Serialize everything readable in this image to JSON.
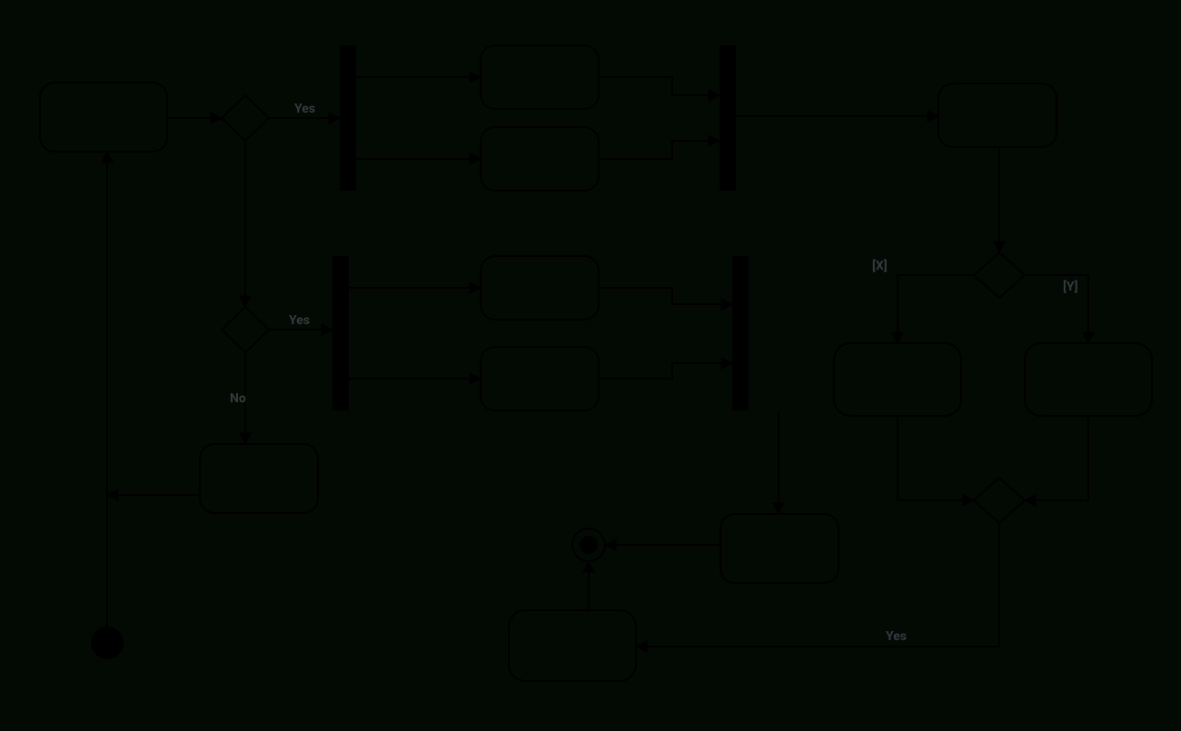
{
  "diagram": {
    "type": "uml-activity",
    "labels": {
      "yes1": "Yes",
      "yes2": "Yes",
      "yes3": "Yes",
      "no": "No",
      "guardX": "[X]",
      "guardY": "[Y]"
    },
    "nodes": {
      "start": {
        "kind": "initial"
      },
      "a_top": {
        "kind": "action"
      },
      "d_top": {
        "kind": "decision"
      },
      "fork1": {
        "kind": "fork"
      },
      "a_f1a": {
        "kind": "action"
      },
      "a_f1b": {
        "kind": "action"
      },
      "join1": {
        "kind": "join"
      },
      "a_right": {
        "kind": "action"
      },
      "d_right": {
        "kind": "decision"
      },
      "a_x": {
        "kind": "action"
      },
      "a_y": {
        "kind": "action"
      },
      "merge_r": {
        "kind": "merge"
      },
      "d_mid": {
        "kind": "decision"
      },
      "fork2": {
        "kind": "fork"
      },
      "a_f2a": {
        "kind": "action"
      },
      "a_f2b": {
        "kind": "action"
      },
      "join2": {
        "kind": "join"
      },
      "a_no": {
        "kind": "action"
      },
      "a_center": {
        "kind": "action"
      },
      "a_bottom": {
        "kind": "action"
      },
      "final": {
        "kind": "final"
      }
    },
    "edges": [
      {
        "from": "start",
        "to": "a_top"
      },
      {
        "from": "a_top",
        "to": "d_top"
      },
      {
        "from": "d_top",
        "to": "fork1",
        "label": "yes1"
      },
      {
        "from": "fork1",
        "to": "a_f1a"
      },
      {
        "from": "fork1",
        "to": "a_f1b"
      },
      {
        "from": "a_f1a",
        "to": "join1"
      },
      {
        "from": "a_f1b",
        "to": "join1"
      },
      {
        "from": "join1",
        "to": "a_right"
      },
      {
        "from": "a_right",
        "to": "d_right"
      },
      {
        "from": "d_right",
        "to": "a_x",
        "label": "guardX"
      },
      {
        "from": "d_right",
        "to": "a_y",
        "label": "guardY"
      },
      {
        "from": "a_x",
        "to": "merge_r"
      },
      {
        "from": "a_y",
        "to": "merge_r"
      },
      {
        "from": "merge_r",
        "to": "a_bottom",
        "label": "yes3"
      },
      {
        "from": "d_top",
        "to": "d_mid"
      },
      {
        "from": "d_mid",
        "to": "fork2",
        "label": "yes2"
      },
      {
        "from": "fork2",
        "to": "a_f2a"
      },
      {
        "from": "fork2",
        "to": "a_f2b"
      },
      {
        "from": "a_f2a",
        "to": "join2"
      },
      {
        "from": "a_f2b",
        "to": "join2"
      },
      {
        "from": "join2",
        "to": "a_center"
      },
      {
        "from": "d_mid",
        "to": "a_no",
        "label": "no"
      },
      {
        "from": "a_no",
        "to": "a_top"
      },
      {
        "from": "a_center",
        "to": "final"
      },
      {
        "from": "a_bottom",
        "to": "final"
      }
    ]
  }
}
